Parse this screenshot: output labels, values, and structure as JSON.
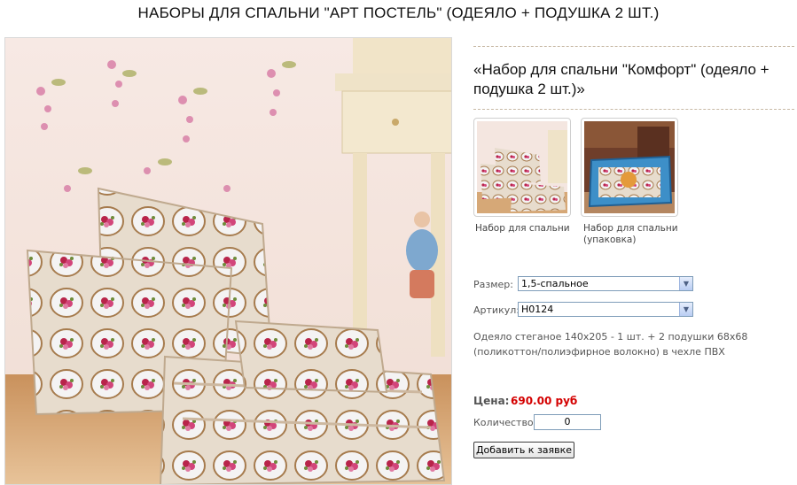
{
  "page": {
    "title": "НАБОРЫ ДЛЯ СПАЛЬНИ \"АРТ ПОСТЕЛЬ\" (ОДЕЯЛО + ПОДУШКА 2 ШТ.)"
  },
  "product": {
    "title_line1": "«Набор для спальни \"Комфорт\" (одеяло +",
    "title_line2": "подушка 2 шт.)»",
    "thumbnails": [
      {
        "caption_line1": "Набор для спальни",
        "caption_line2": ""
      },
      {
        "caption_line1": "Набор для спальни",
        "caption_line2": "(упаковка)"
      }
    ],
    "options": {
      "size_label": "Размер:",
      "size_value": "1,5-спальное",
      "article_label": "Артикул:",
      "article_value": "Н0124"
    },
    "description_line1": "Одеяло стеганое 140х205 - 1 шт. + 2 подушки 68х68",
    "description_line2": "(поликоттон/полиэфирное волокно) в чехле ПВХ",
    "price_label": "Цена:",
    "price_value": "690.00 руб",
    "quantity_label": "Количество:",
    "quantity_value": "0",
    "add_button_label": "Добавить к заявке"
  },
  "icons": {
    "select_arrow": "chevron-down-icon"
  },
  "colors": {
    "price": "#d40000",
    "divider": "#c8b9a5",
    "input_border": "#7f9db9"
  }
}
